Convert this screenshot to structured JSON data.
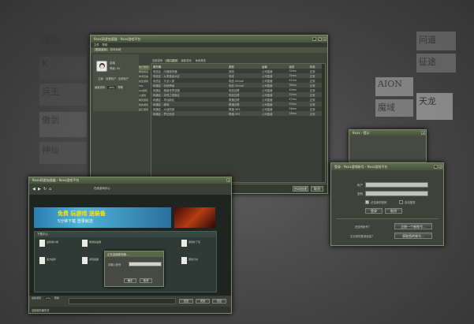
{
  "background_tiles": [
    {
      "label": "寻仙",
      "color": "#3a3a3a"
    },
    {
      "label": "K",
      "color": "#4a4a4a"
    },
    {
      "label": "兵王",
      "color": "#555"
    },
    {
      "label": "傲剑",
      "color": "#6a6a6a"
    },
    {
      "label": "神仙",
      "color": "#5d5d5d"
    },
    {
      "label": "AION",
      "color": "#d0d0d0"
    },
    {
      "label": "天龙",
      "color": "#e0e0e0"
    },
    {
      "label": "魔域",
      "color": "#bdbdbd"
    },
    {
      "label": "问道",
      "color": "#8a8a8a"
    },
    {
      "label": "征途",
      "color": "#909090"
    }
  ],
  "main_window": {
    "title": "9xxx网游加速器 - 9xxx游戏平台",
    "menu": [
      "文件",
      "帮助"
    ],
    "toolbar": [
      "登录游戏",
      "游戏商城"
    ],
    "user": {
      "name": "游客",
      "level": "等级: 0V",
      "links": [
        "注销",
        "设置帐户",
        "全部帐户"
      ],
      "tags": [
        "最新游戏",
        "play",
        "帮助"
      ]
    },
    "categories": [
      "热门游戏",
      "角色扮演",
      "休闲竞技",
      "射击游戏",
      "FPS",
      "QQ游戏",
      "小游戏",
      "网页游戏",
      "我的游戏",
      "其它游戏"
    ],
    "tabs": [
      "全部游戏",
      "热门游戏",
      "最新游戏",
      "休闲竞技"
    ],
    "columns": [
      "服务器",
      "类型",
      "运营",
      "延迟",
      "状态"
    ],
    "rows": [
      {
        "name": "电信区 - 问道服务器",
        "type": "双线",
        "op": "公司直营",
        "ping": "32ms",
        "state": "正常"
      },
      {
        "name": "电信区 - 九阴真经大区",
        "type": "双线",
        "op": "公司直营",
        "ping": "35ms",
        "state": "正常"
      },
      {
        "name": "电信区 - 天龙八部",
        "type": "电信 Virtual",
        "op": "公司直营",
        "ping": "41ms",
        "state": "正常"
      },
      {
        "name": "网通区 - 剑侠情缘",
        "type": "电信 Virtual",
        "op": "公司直营",
        "ping": "38ms",
        "state": "正常"
      },
      {
        "name": "网通区 - 魔兽世界亚服",
        "type": "电信互联",
        "op": "公司直营",
        "ping": "44ms",
        "state": "正常"
      },
      {
        "name": "网通区 - 永恒之塔新区",
        "type": "电信互联",
        "op": "公司直营",
        "ping": "52ms",
        "state": "正常"
      },
      {
        "name": "网通区 - 寻仙新区",
        "type": "联通互联",
        "op": "公司直营",
        "ping": "47ms",
        "state": "正常"
      },
      {
        "name": "网通区 - 魔域",
        "type": "联通互联",
        "op": "公司直营",
        "ping": "50ms",
        "state": "正常"
      },
      {
        "name": "网通区 - 大话西游",
        "type": "联通 VPS",
        "op": "公司直营",
        "ping": "56ms",
        "state": "正常"
      },
      {
        "name": "网通区 - 梦幻西游",
        "type": "联通 VPS",
        "op": "公司直营",
        "ping": "58ms",
        "state": "正常"
      }
    ],
    "status": "已完成游戏列表加载",
    "footer_buttons": [
      "启动加速",
      "取消"
    ]
  },
  "small_window": {
    "title": "9xxx - 提示"
  },
  "login_window": {
    "title": "登录 - 9xxx游戏帐号 - 9xxx游戏平台",
    "account_label": "帐户",
    "account_value": "",
    "password_label": "密码",
    "password_value": "",
    "remember_label": "记住我的密码",
    "auto_label": "自动登录",
    "login_button": "登录",
    "cancel_button": "取消",
    "no_account_q": "还没有帐号？",
    "register_button": "注册一个新帐号...",
    "forgot_q": "忘记你的登录信息？",
    "retrieve_button": "获取您的帐号..."
  },
  "browser_window": {
    "title": "9xxx网游加速器 - 9xxx游戏平台",
    "toolbar_label": "在线游戏中心",
    "banner_text": "免费 玩游戏 送装备",
    "banner_sub": "5分钟下载 登录就送",
    "section_title": "下载中心",
    "files": [
      "最新客户端",
      "网游加速器",
      "游戏补丁包",
      "官方插件",
      "游戏截图",
      "更新日志"
    ],
    "dialog_title": "正在连接服务器...",
    "dialog_label": "请输入帐号",
    "dialog_buttons": [
      "确定",
      "取消"
    ],
    "footer_tags": [
      "最新游戏",
      "play",
      "帮助"
    ],
    "footer_buttons": [
      "发送",
      "关闭",
      "清空"
    ],
    "status": "连接服务器完成"
  }
}
